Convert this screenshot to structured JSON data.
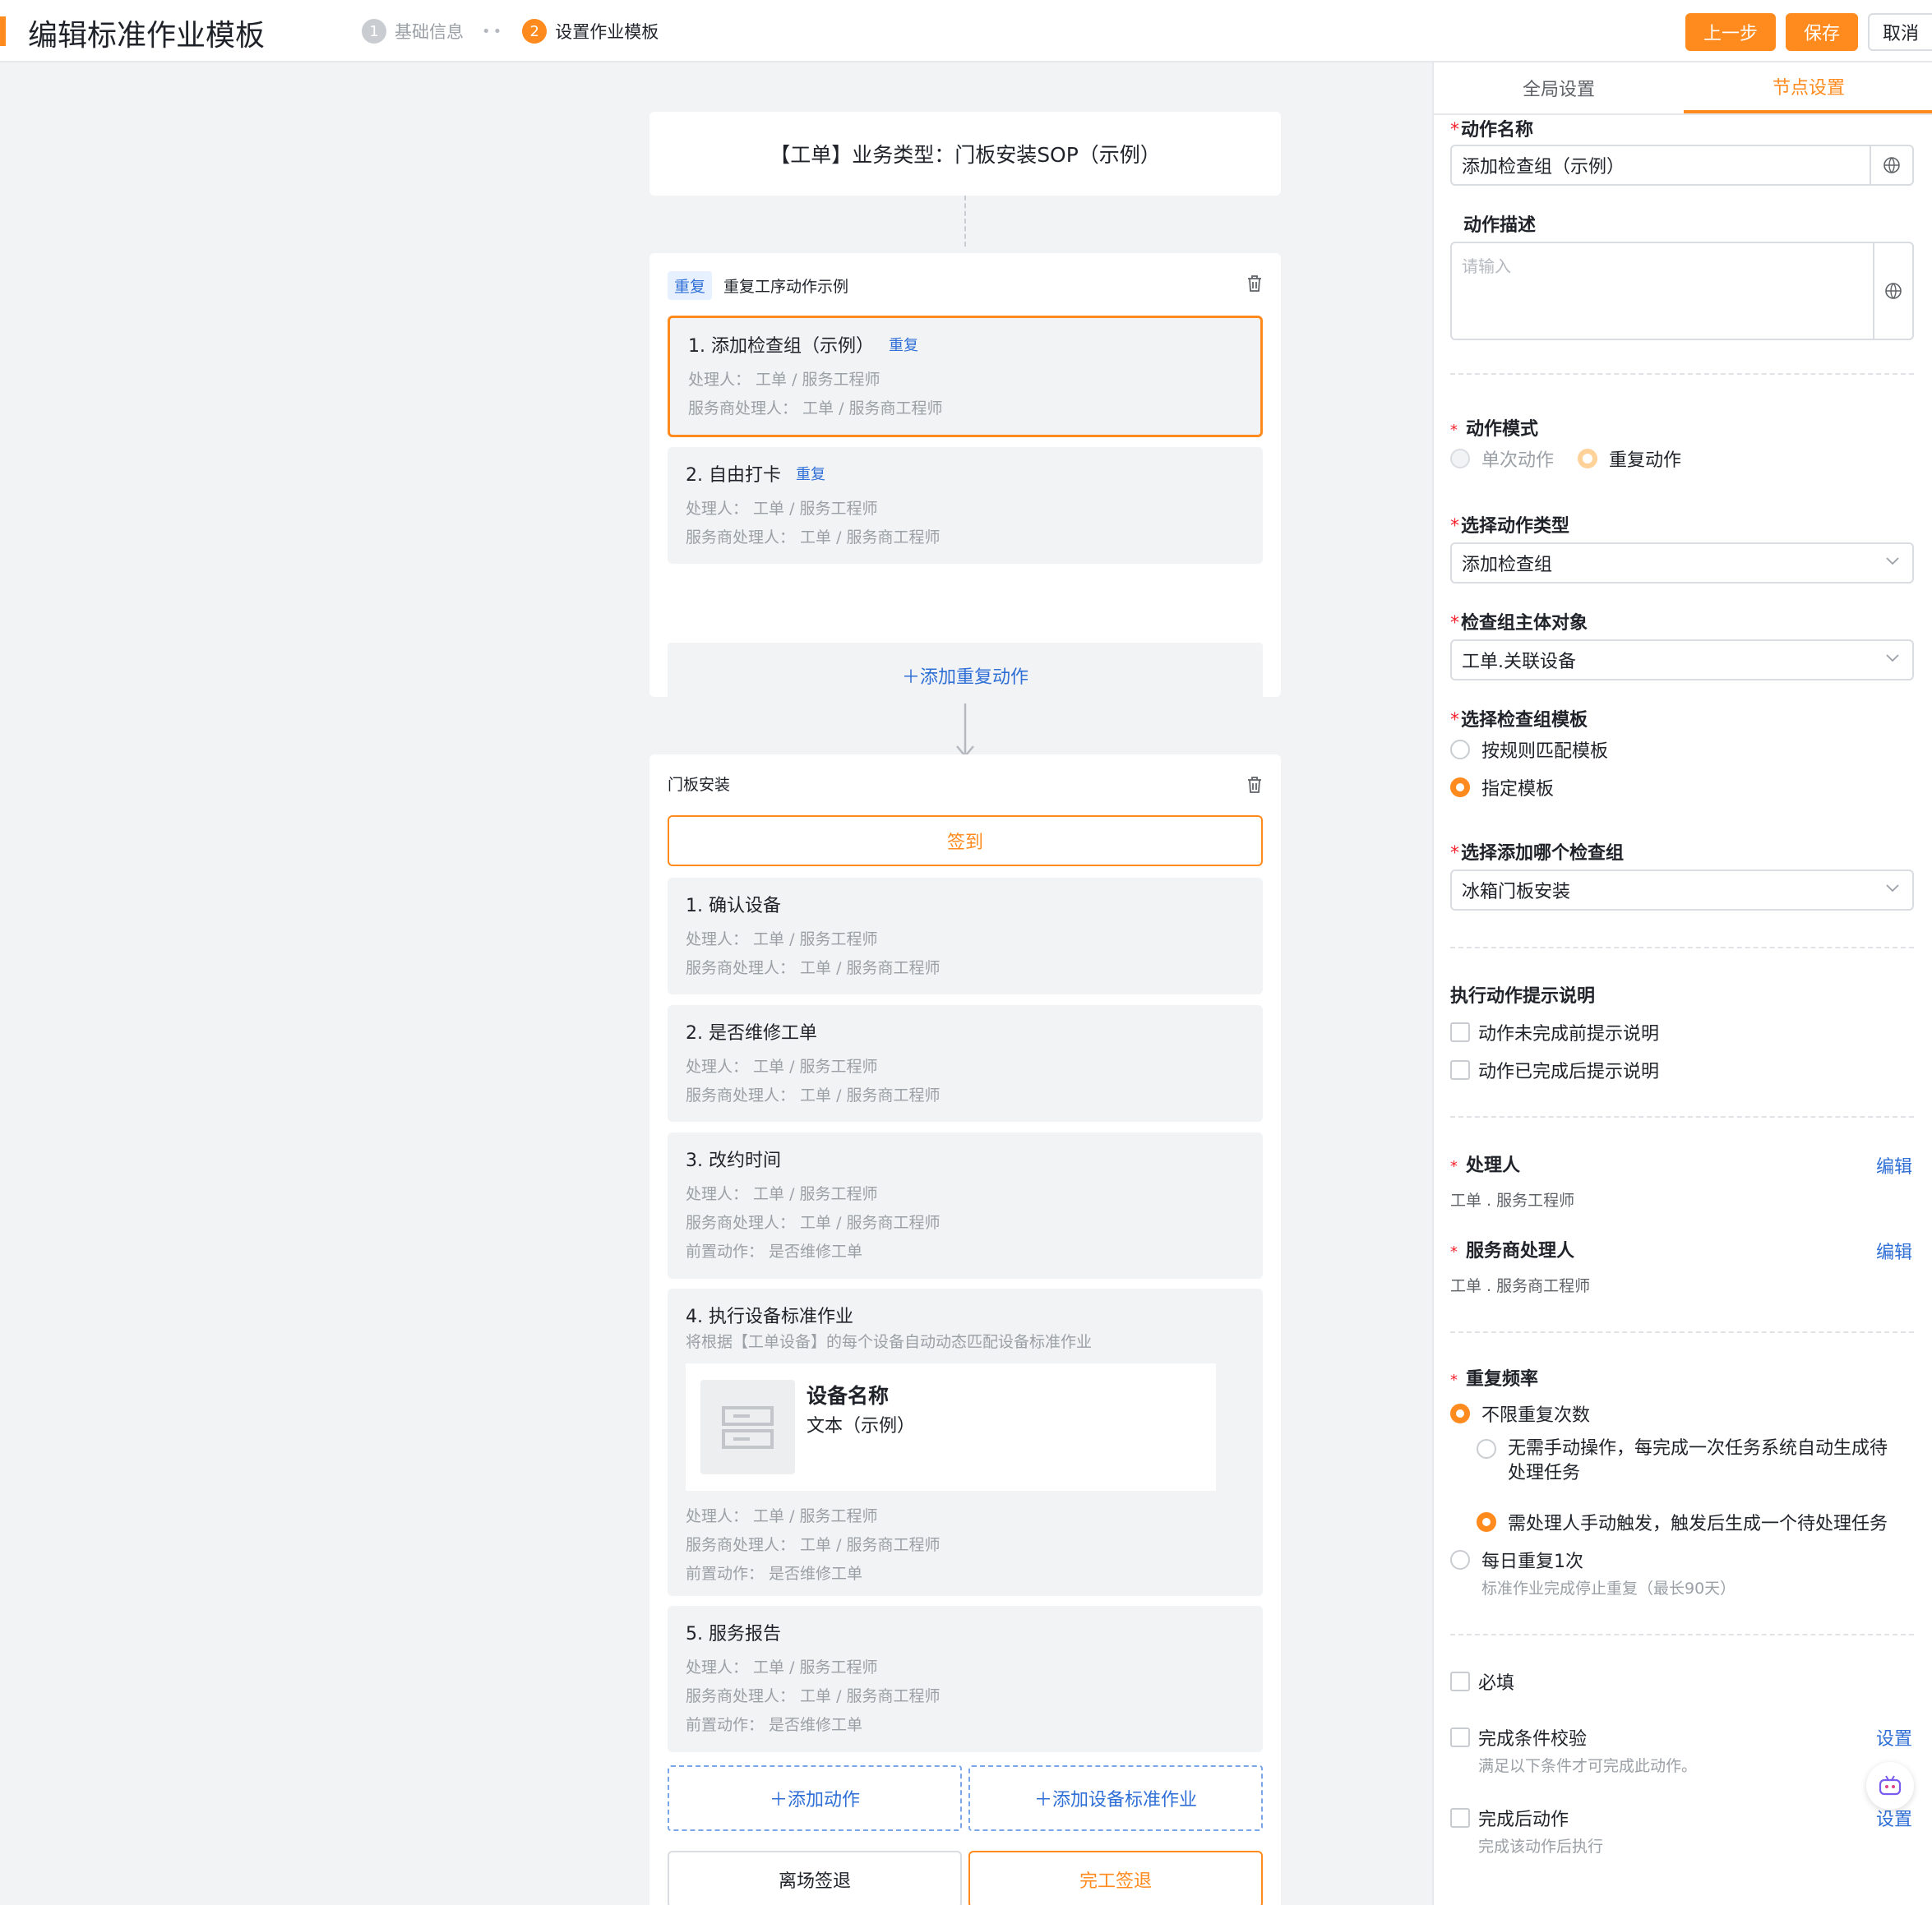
{
  "header": {
    "title": "编辑标准作业模板",
    "steps": [
      {
        "num": "1",
        "label": "基础信息"
      },
      {
        "num": "2",
        "label": "设置作业模板"
      }
    ],
    "separator": "••",
    "buttons": {
      "prev": "上一步",
      "save": "保存",
      "cancel": "取消"
    }
  },
  "canvas": {
    "title_card": "【工单】业务类型：门板安装SOP（示例）",
    "repeat_section": {
      "tag": "重复",
      "title": "重复工序动作示例",
      "actions": [
        {
          "title": "1. 添加检查组（示例）",
          "tag": "重复",
          "handler": "处理人：  工单 / 服务工程师",
          "sp_handler": "服务商处理人：  工单 / 服务商工程师"
        },
        {
          "title": "2. 自由打卡",
          "tag": "重复",
          "handler": "处理人：  工单 / 服务工程师",
          "sp_handler": "服务商处理人：  工单 / 服务商工程师"
        }
      ],
      "add_button": "＋添加重复动作"
    },
    "install_section": {
      "title": "门板安装",
      "checkin": "签到",
      "actions": [
        {
          "title": "1. 确认设备",
          "handler": "处理人：  工单 / 服务工程师",
          "sp_handler": "服务商处理人：  工单 / 服务商工程师"
        },
        {
          "title": "2. 是否维修工单",
          "handler": "处理人：  工单 / 服务工程师",
          "sp_handler": "服务商处理人：  工单 / 服务商工程师"
        },
        {
          "title": "3. 改约时间",
          "handler": "处理人：  工单 / 服务工程师",
          "sp_handler": "服务商处理人：  工单 / 服务商工程师",
          "pre": "前置动作：  是否维修工单"
        },
        {
          "title": "4. 执行设备标准作业",
          "subtitle": "将根据【工单设备】的每个设备自动动态匹配设备标准作业",
          "device_name": "设备名称",
          "device_text": "文本（示例）",
          "handler": "处理人：  工单 / 服务工程师",
          "sp_handler": "服务商处理人：  工单 / 服务商工程师",
          "pre": "前置动作：  是否维修工单"
        },
        {
          "title": "5. 服务报告",
          "handler": "处理人：  工单 / 服务工程师",
          "sp_handler": "服务商处理人：  工单 / 服务商工程师",
          "pre": "前置动作：  是否维修工单"
        }
      ],
      "add_action": "＋添加动作",
      "add_device_job": "＋添加设备标准作业",
      "leave_checkout": "离场签退",
      "finish_checkout": "完工签退"
    }
  },
  "panel": {
    "tabs": [
      "全局设置",
      "节点设置"
    ],
    "action_name_label": "动作名称",
    "action_name_value": "添加检查组（示例）",
    "action_desc_label": "动作描述",
    "action_desc_placeholder": "请输入",
    "mode_label": "动作模式",
    "mode_options": [
      "单次动作",
      "重复动作"
    ],
    "type_label": "选择动作类型",
    "type_value": "添加检查组",
    "subject_label": "检查组主体对象",
    "subject_value": "工单.关联设备",
    "template_label": "选择检查组模板",
    "template_options": [
      "按规则匹配模板",
      "指定模板"
    ],
    "which_label": "选择添加哪个检查组",
    "which_value": "冰箱门板安装",
    "hint_label": "执行动作提示说明",
    "hint_options": [
      "动作未完成前提示说明",
      "动作已完成后提示说明"
    ],
    "handler_label": "处理人",
    "handler_value": "工单 . 服务工程师",
    "sp_handler_label": "服务商处理人",
    "sp_handler_value": "工单 . 服务商工程师",
    "edit": "编辑",
    "freq_label": "重复频率",
    "freq_unlimited": "不限重复次数",
    "freq_auto": "无需手动操作，每完成一次任务系统自动生成待处理任务",
    "freq_manual": "需处理人手动触发，触发后生成一个待处理任务",
    "freq_daily": "每日重复1次",
    "freq_daily_note": "标准作业完成停止重复（最长90天）",
    "required": "必填",
    "complete_check": "完成条件校验",
    "complete_check_note": "满足以下条件才可完成此动作。",
    "after_action": "完成后动作",
    "after_action_note": "完成该动作后执行",
    "setting": "设置"
  }
}
